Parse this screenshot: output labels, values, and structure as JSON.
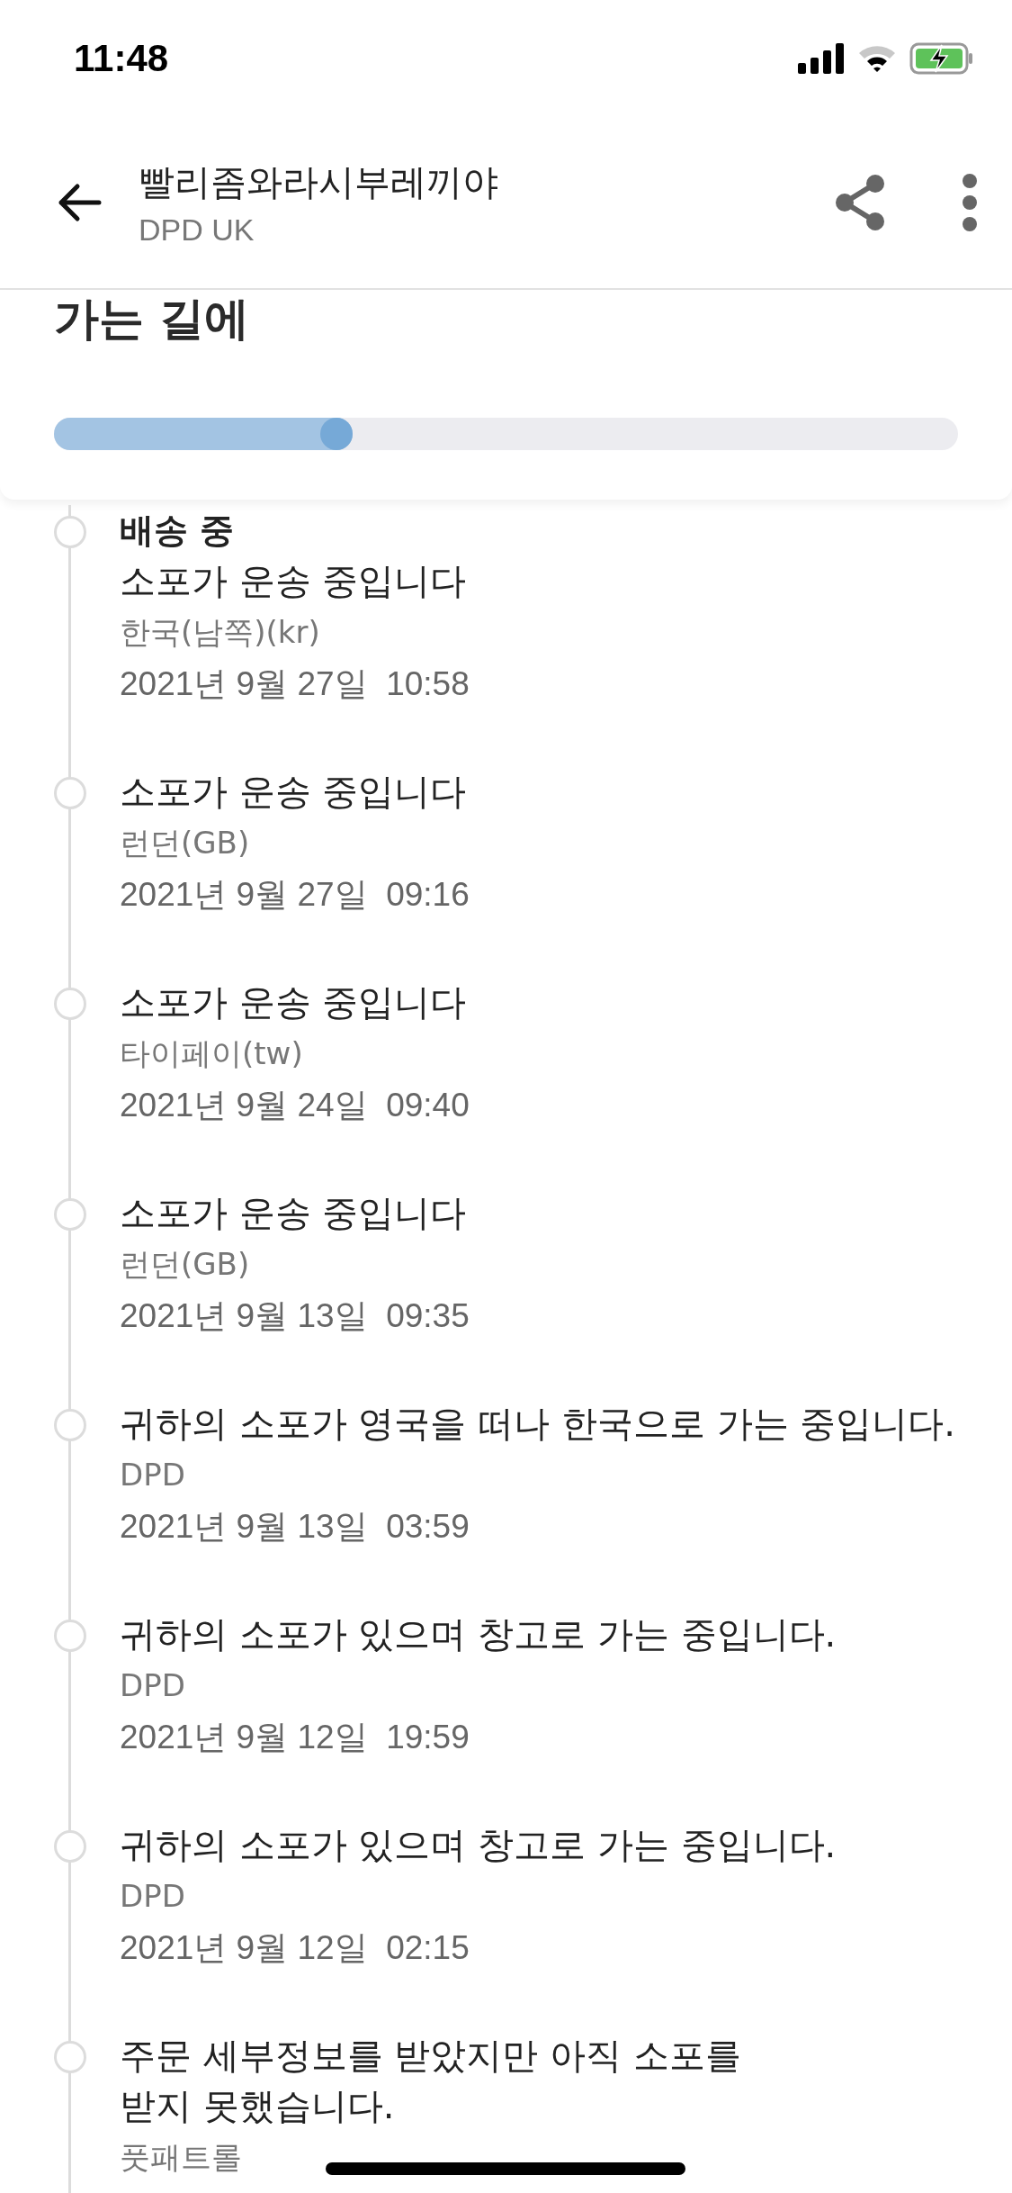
{
  "status_bar": {
    "time": "11:48",
    "battery_charging": true
  },
  "header": {
    "title": "빨리좀와라시부레끼야",
    "subtitle": "DPD UK"
  },
  "summary": {
    "heading": "가는 길에",
    "progress": {
      "level": 0.33
    }
  },
  "events": [
    {
      "status": "배송 중",
      "message": "소포가 운송 중입니다",
      "location": "한국(남쪽)(kr)",
      "datetime": "2021년 9월 27일  10:58"
    },
    {
      "message": "소포가 운송 중입니다",
      "location": "런던(GB)",
      "datetime": "2021년 9월 27일  09:16"
    },
    {
      "message": "소포가 운송 중입니다",
      "location": "타이페이(tw)",
      "datetime": "2021년 9월 24일  09:40"
    },
    {
      "message": "소포가 운송 중입니다",
      "location": "런던(GB)",
      "datetime": "2021년 9월 13일  09:35"
    },
    {
      "message": "귀하의 소포가 영국을 떠나 한국으로 가는 중입니다.",
      "location": "DPD",
      "datetime": "2021년 9월 13일  03:59"
    },
    {
      "message": "귀하의 소포가 있으며 창고로 가는 중입니다.",
      "location": "DPD",
      "datetime": "2021년 9월 12일  19:59"
    },
    {
      "message": "귀하의 소포가 있으며 창고로 가는 중입니다.",
      "location": "DPD",
      "datetime": "2021년 9월 12일  02:15"
    },
    {
      "message": "주문 세부정보를 받았지만 아직 소포를\n받지 못했습니다.",
      "location": "풋패트롤"
    }
  ]
}
